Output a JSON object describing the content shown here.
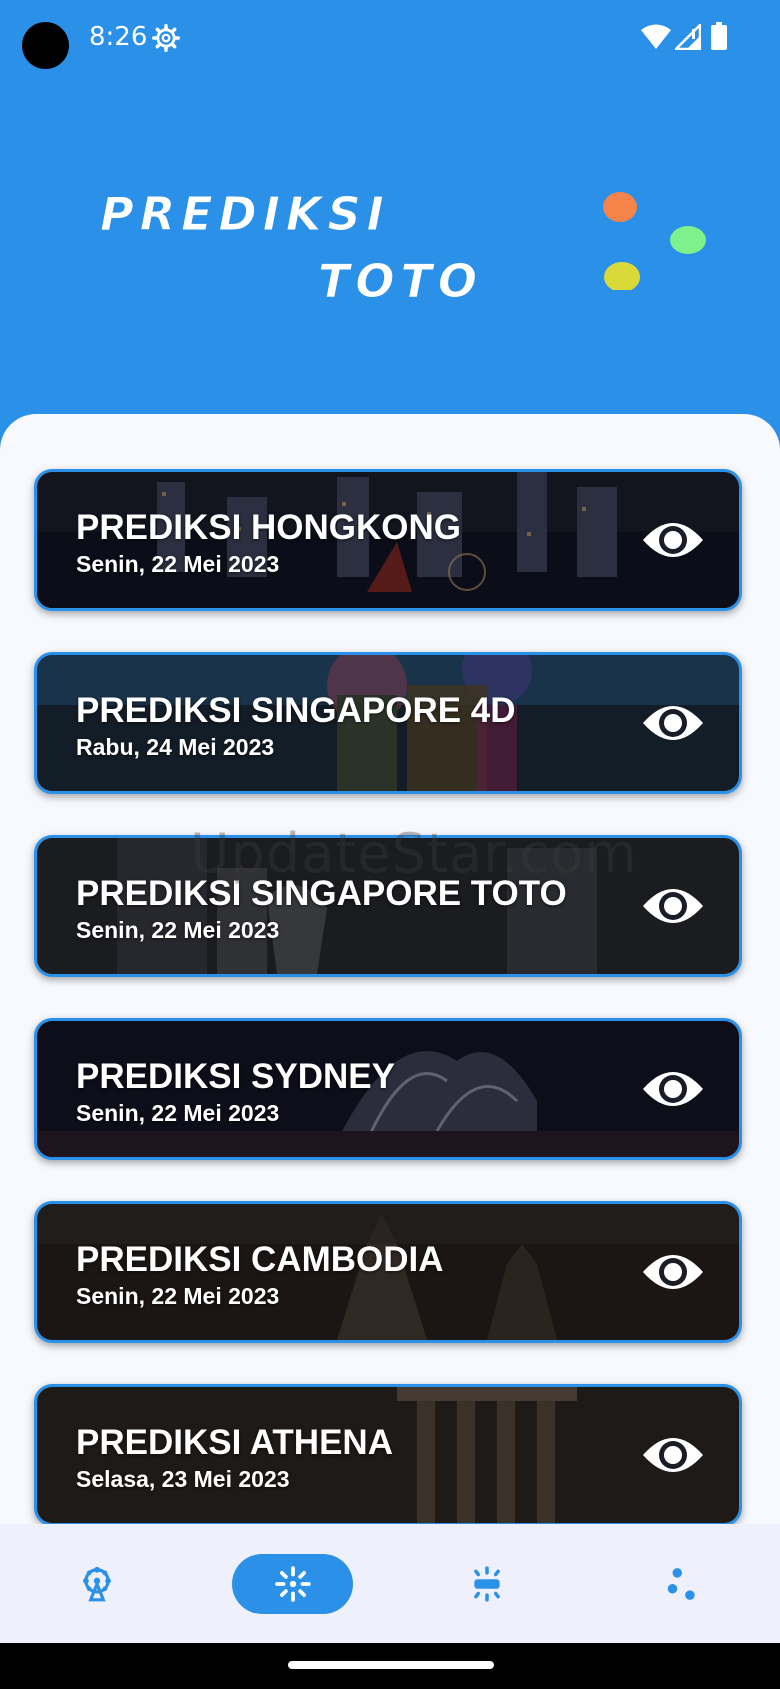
{
  "status_bar": {
    "time": "8:26"
  },
  "header": {
    "logo_line1": "PREDIKSI",
    "logo_line2": "TOTO"
  },
  "watermark": "UpdateStar.com",
  "cards": [
    {
      "title": "PREDIKSI HONGKONG",
      "date": "Senin, 22 Mei 2023"
    },
    {
      "title": "PREDIKSI SINGAPORE 4D",
      "date": "Rabu, 24 Mei 2023"
    },
    {
      "title": "PREDIKSI SINGAPORE TOTO",
      "date": "Senin, 22 Mei 2023"
    },
    {
      "title": "PREDIKSI SYDNEY",
      "date": "Senin, 22 Mei 2023"
    },
    {
      "title": "PREDIKSI CAMBODIA",
      "date": "Senin, 22 Mei 2023"
    },
    {
      "title": "PREDIKSI ATHENA",
      "date": "Selasa, 23 Mei 2023"
    }
  ],
  "bottom_nav": {
    "items": [
      "ferris-wheel-icon",
      "sparkle-icon",
      "lamp-icon",
      "dots-icon"
    ],
    "active_index": 1
  },
  "colors": {
    "primary": "#2b90e8",
    "sheet": "#f7f9fe",
    "ball_orange": "#f5844a",
    "ball_green": "#7ef08c",
    "ball_yellow": "#d9d93a"
  }
}
